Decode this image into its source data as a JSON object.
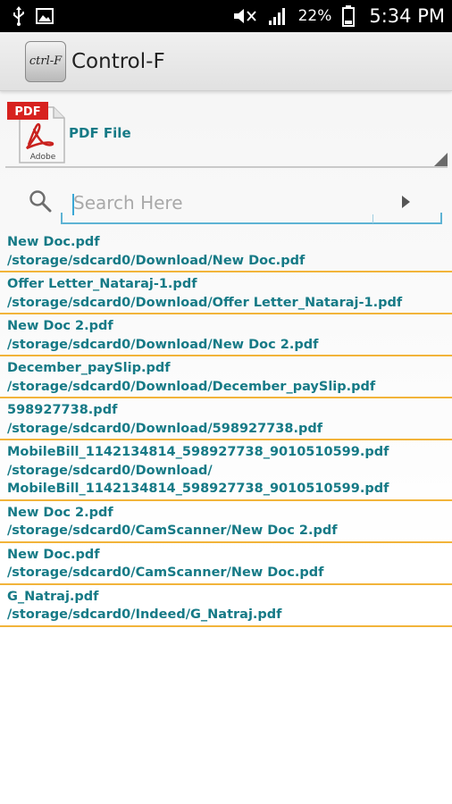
{
  "status_bar": {
    "battery_percent": "22%",
    "time": "5:34 PM"
  },
  "app": {
    "title": "Control-F",
    "logo_text": "ctrl-F"
  },
  "file_type": {
    "selected": "PDF File",
    "icon": "pdf-adobe-icon",
    "icon_badge": "PDF",
    "icon_caption": "Adobe"
  },
  "search": {
    "placeholder": "Search Here",
    "value": ""
  },
  "results": [
    {
      "name": "New Doc.pdf",
      "path": "/storage/sdcard0/Download/New Doc.pdf"
    },
    {
      "name": "Offer Letter_Nataraj-1.pdf",
      "path": "/storage/sdcard0/Download/Offer Letter_Nataraj-1.pdf"
    },
    {
      "name": "New Doc 2.pdf",
      "path": "/storage/sdcard0/Download/New Doc 2.pdf"
    },
    {
      "name": "December_paySlip.pdf",
      "path": "/storage/sdcard0/Download/December_paySlip.pdf"
    },
    {
      "name": "598927738.pdf",
      "path": "/storage/sdcard0/Download/598927738.pdf"
    },
    {
      "name": "MobileBill_1142134814_598927738_9010510599.pdf",
      "path": "/storage/sdcard0/Download/\nMobileBill_1142134814_598927738_9010510599.pdf"
    },
    {
      "name": "New Doc 2.pdf",
      "path": "/storage/sdcard0/CamScanner/New Doc 2.pdf"
    },
    {
      "name": "New Doc.pdf",
      "path": "/storage/sdcard0/CamScanner/New Doc.pdf"
    },
    {
      "name": "G_Natraj.pdf",
      "path": "/storage/sdcard0/Indeed/G_Natraj.pdf"
    }
  ],
  "colors": {
    "link_teal": "#167a86",
    "separator_orange": "#f2b43a",
    "input_underline": "#5eb3d4"
  }
}
